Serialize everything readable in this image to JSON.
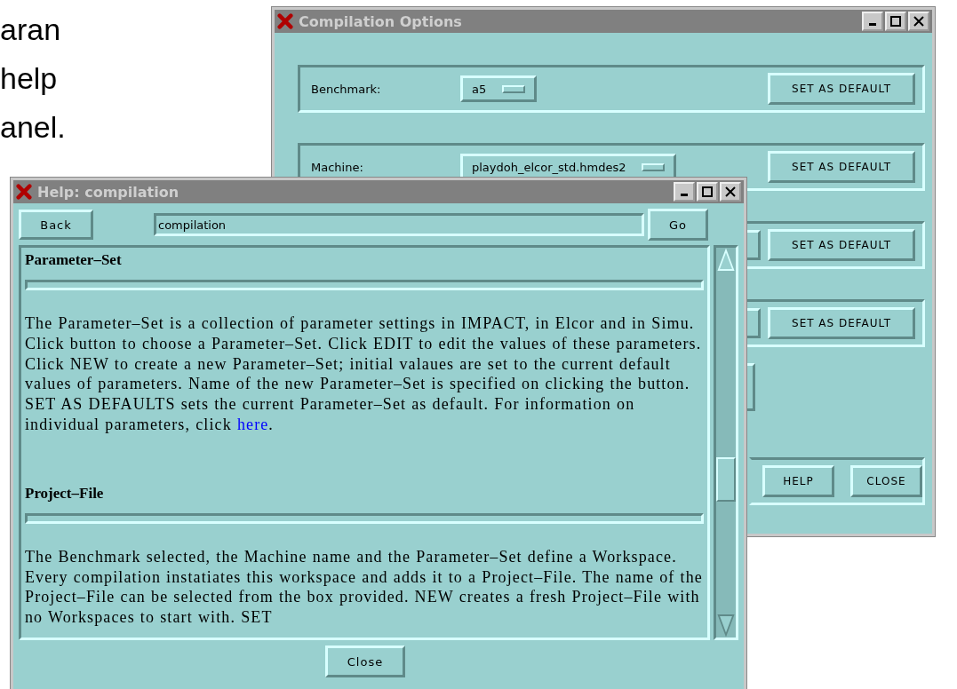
{
  "slide_text": [
    "aran",
    "help",
    "anel."
  ],
  "compilation_window": {
    "title": "Compilation Options",
    "rows": [
      {
        "label": "Benchmark:",
        "value": "a5",
        "button": "SET AS DEFAULT"
      },
      {
        "label": "Machine:",
        "value": "playdoh_elcor_std.hmdes2",
        "button": "SET AS DEFAULT"
      },
      {
        "button": "SET AS DEFAULT"
      },
      {
        "button": "SET AS DEFAULT"
      }
    ],
    "buttons": [
      "HELP",
      "CLOSE"
    ]
  },
  "help_window": {
    "title": "Help: compilation",
    "back": "Back",
    "address": "compilation",
    "go": "Go",
    "sections": [
      {
        "heading": "Parameter–Set",
        "text": "The Parameter–Set is a collection of parameter settings in IMPACT, in Elcor and in Simu. Click button to choose a Parameter–Set. Click EDIT to edit the values of these parameters. Click NEW to create a new Parameter–Set; initial valaues are set to the current default values of parameters. Name of the new Parameter–Set is specified on clicking the button. SET AS DEFAULTS sets the current Parameter–Set as default. For information on individual parameters, click ",
        "link": "here",
        "after": "."
      },
      {
        "heading": "Project–File",
        "text": "The Benchmark selected, the Machine name and the Parameter–Set define a Workspace. Every compilation instatiates this workspace and adds it to a Project–File. The name of the Project–File can be selected from the box provided. NEW creates a fresh Project–File with no Workspaces to start with. SET"
      }
    ],
    "close": "Close"
  }
}
